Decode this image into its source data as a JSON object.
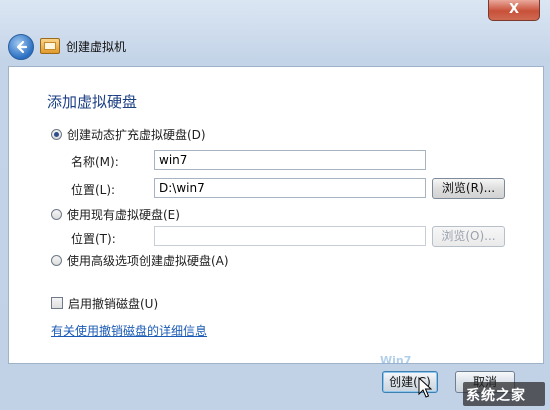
{
  "window": {
    "title": "创建虚拟机",
    "close_label": "X"
  },
  "heading": "添加虚拟硬盘",
  "options": {
    "create_dynamic": {
      "label": "创建动态扩充虚拟硬盘(D)",
      "checked": true,
      "name_label": "名称(M):",
      "name_value": "win7",
      "location_label": "位置(L):",
      "location_value": "D:\\win7",
      "browse_label": "浏览(R)..."
    },
    "use_existing": {
      "label": "使用现有虚拟硬盘(E)",
      "checked": false,
      "location_label": "位置(T):",
      "location_value": "",
      "browse_label": "浏览(O)..."
    },
    "use_advanced": {
      "label": "使用高级选项创建虚拟硬盘(A)",
      "checked": false
    }
  },
  "undo_disks": {
    "label": "启用撤销磁盘(U)",
    "checked": false
  },
  "details_link": "有关使用撤销磁盘的详细信息",
  "footer": {
    "create_label": "创建(C)",
    "cancel_label": "取消"
  },
  "watermark": {
    "text": "系统之家",
    "faint_text": "Win7"
  },
  "icons": {
    "back": "back-arrow-icon",
    "window": "virtual-machine-icon",
    "cursor": "mouse-pointer-icon"
  }
}
